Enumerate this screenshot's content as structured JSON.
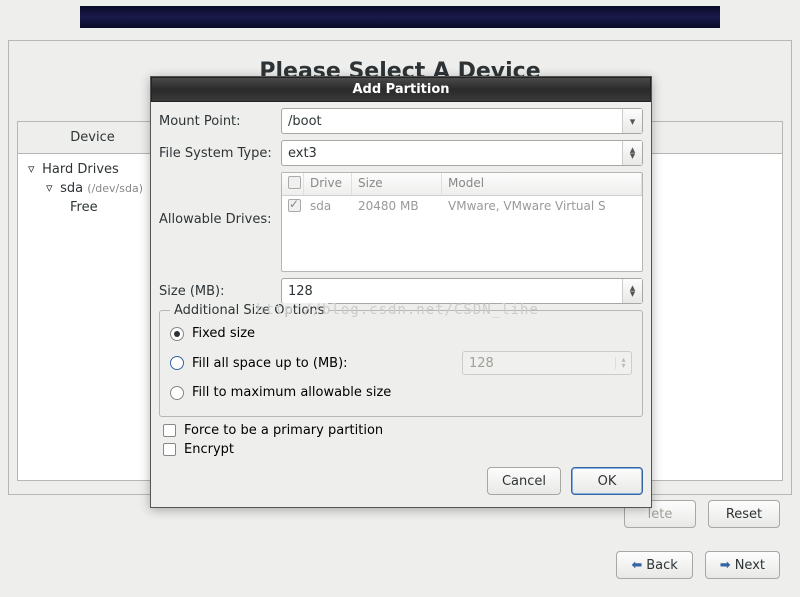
{
  "banner": {},
  "background": {
    "title": "Please Select A Device",
    "table_headers": {
      "device": "Device"
    },
    "tree": {
      "root": "Hard Drives",
      "drive": "sda",
      "drive_path": "(/dev/sda)",
      "free": "Free"
    },
    "buttons": {
      "delete_partial": "lete",
      "reset": "Reset"
    }
  },
  "nav": {
    "back": "Back",
    "next": "Next"
  },
  "dialog": {
    "title": "Add Partition",
    "labels": {
      "mount_point": "Mount Point:",
      "fs_type": "File System Type:",
      "allowable_drives": "Allowable Drives:",
      "size_mb": "Size (MB):",
      "additional_size": "Additional Size Options",
      "fixed_size": "Fixed size",
      "fill_up_to": "Fill all space up to (MB):",
      "fill_max": "Fill to maximum allowable size",
      "force_primary": "Force to be a primary partition",
      "encrypt": "Encrypt"
    },
    "values": {
      "mount_point": "/boot",
      "fs_type": "ext3",
      "size_mb": "128",
      "fill_up_to_value": "128"
    },
    "drive_table": {
      "headers": {
        "drive": "Drive",
        "size": "Size",
        "model": "Model"
      },
      "rows": [
        {
          "checked": true,
          "drive": "sda",
          "size": "20480 MB",
          "model": "VMware, VMware Virtual S"
        }
      ]
    },
    "actions": {
      "cancel": "Cancel",
      "ok": "OK"
    }
  },
  "watermark": "http://blog.csdn.net/CSDN_lihe"
}
